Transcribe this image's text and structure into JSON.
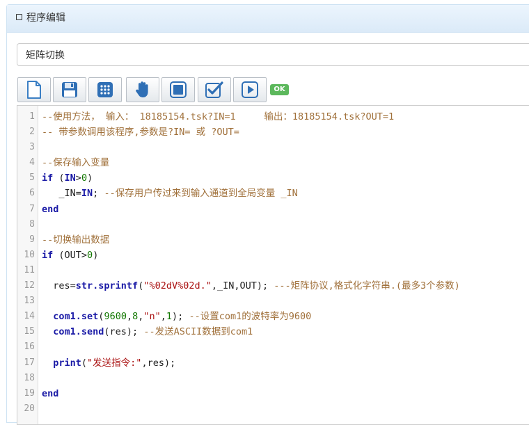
{
  "panel": {
    "title": "程序编辑"
  },
  "program": {
    "name": "矩阵切换"
  },
  "toolbar": {
    "buttons": [
      {
        "name": "new-file-button",
        "icon": "new-file-icon"
      },
      {
        "name": "save-button",
        "icon": "floppy-disk-icon"
      },
      {
        "name": "keypad-button",
        "icon": "keypad-icon"
      },
      {
        "name": "hand-button",
        "icon": "hand-icon"
      },
      {
        "name": "stop-button",
        "icon": "stop-icon"
      },
      {
        "name": "check-button",
        "icon": "checkbox-icon"
      },
      {
        "name": "run-button",
        "icon": "play-icon"
      }
    ],
    "status": "OK"
  },
  "colors": {
    "accent": "#4a90d9",
    "ok": "#5cb85c",
    "comment": "#a0703a",
    "keyword": "#1a1aa6",
    "number": "#117700",
    "string": "#aa1111"
  },
  "editor": {
    "lines": [
      {
        "no": "1",
        "tokens": [
          {
            "t": "comment",
            "v": "--使用方法， 输入： 18185154.tsk?IN=1     输出：18185154.tsk?OUT=1"
          }
        ]
      },
      {
        "no": "2",
        "tokens": [
          {
            "t": "comment",
            "v": "-- 带参数调用该程序,参数是?IN= 或 ?OUT="
          }
        ]
      },
      {
        "no": "3",
        "tokens": []
      },
      {
        "no": "4",
        "tokens": [
          {
            "t": "comment",
            "v": "--保存输入变量"
          }
        ]
      },
      {
        "no": "5",
        "tokens": [
          {
            "t": "keyword",
            "v": "if"
          },
          {
            "t": "text",
            "v": " ("
          },
          {
            "t": "keyword",
            "v": "IN"
          },
          {
            "t": "text",
            "v": ">"
          },
          {
            "t": "number",
            "v": "0"
          },
          {
            "t": "text",
            "v": ")"
          }
        ]
      },
      {
        "no": "6",
        "tokens": [
          {
            "t": "text",
            "v": "   _IN="
          },
          {
            "t": "keyword",
            "v": "IN"
          },
          {
            "t": "text",
            "v": "; "
          },
          {
            "t": "comment",
            "v": "--保存用户传过来到输入通道到全局变量 _IN"
          }
        ]
      },
      {
        "no": "7",
        "tokens": [
          {
            "t": "keyword",
            "v": "end"
          }
        ]
      },
      {
        "no": "8",
        "tokens": []
      },
      {
        "no": "9",
        "tokens": [
          {
            "t": "comment",
            "v": "--切换输出数据"
          }
        ]
      },
      {
        "no": "10",
        "tokens": [
          {
            "t": "keyword",
            "v": "if"
          },
          {
            "t": "text",
            "v": " (OUT>"
          },
          {
            "t": "number",
            "v": "0"
          },
          {
            "t": "text",
            "v": ")"
          }
        ]
      },
      {
        "no": "11",
        "tokens": []
      },
      {
        "no": "12",
        "tokens": [
          {
            "t": "text",
            "v": "  res="
          },
          {
            "t": "builtin",
            "v": "str.sprintf"
          },
          {
            "t": "text",
            "v": "("
          },
          {
            "t": "string",
            "v": "\"%02dV%02d.\""
          },
          {
            "t": "text",
            "v": ",_IN,OUT); "
          },
          {
            "t": "comment",
            "v": "---矩阵协议,格式化字符串.(最多3个参数)"
          }
        ]
      },
      {
        "no": "13",
        "tokens": []
      },
      {
        "no": "14",
        "tokens": [
          {
            "t": "text",
            "v": "  "
          },
          {
            "t": "builtin",
            "v": "com1.set"
          },
          {
            "t": "text",
            "v": "("
          },
          {
            "t": "number",
            "v": "9600"
          },
          {
            "t": "text",
            "v": ","
          },
          {
            "t": "number",
            "v": "8"
          },
          {
            "t": "text",
            "v": ","
          },
          {
            "t": "string",
            "v": "\"n\""
          },
          {
            "t": "text",
            "v": ","
          },
          {
            "t": "number",
            "v": "1"
          },
          {
            "t": "text",
            "v": "); "
          },
          {
            "t": "comment",
            "v": "--设置com1的波特率为9600"
          }
        ]
      },
      {
        "no": "15",
        "tokens": [
          {
            "t": "text",
            "v": "  "
          },
          {
            "t": "builtin",
            "v": "com1.send"
          },
          {
            "t": "text",
            "v": "(res); "
          },
          {
            "t": "comment",
            "v": "--发送ASCII数据到com1"
          }
        ]
      },
      {
        "no": "16",
        "tokens": []
      },
      {
        "no": "17",
        "tokens": [
          {
            "t": "text",
            "v": "  "
          },
          {
            "t": "builtin",
            "v": "print"
          },
          {
            "t": "text",
            "v": "("
          },
          {
            "t": "string",
            "v": "\"发送指令:\""
          },
          {
            "t": "text",
            "v": ",res);"
          }
        ]
      },
      {
        "no": "18",
        "tokens": []
      },
      {
        "no": "19",
        "tokens": [
          {
            "t": "keyword",
            "v": "end"
          }
        ]
      },
      {
        "no": "20",
        "tokens": []
      }
    ]
  }
}
